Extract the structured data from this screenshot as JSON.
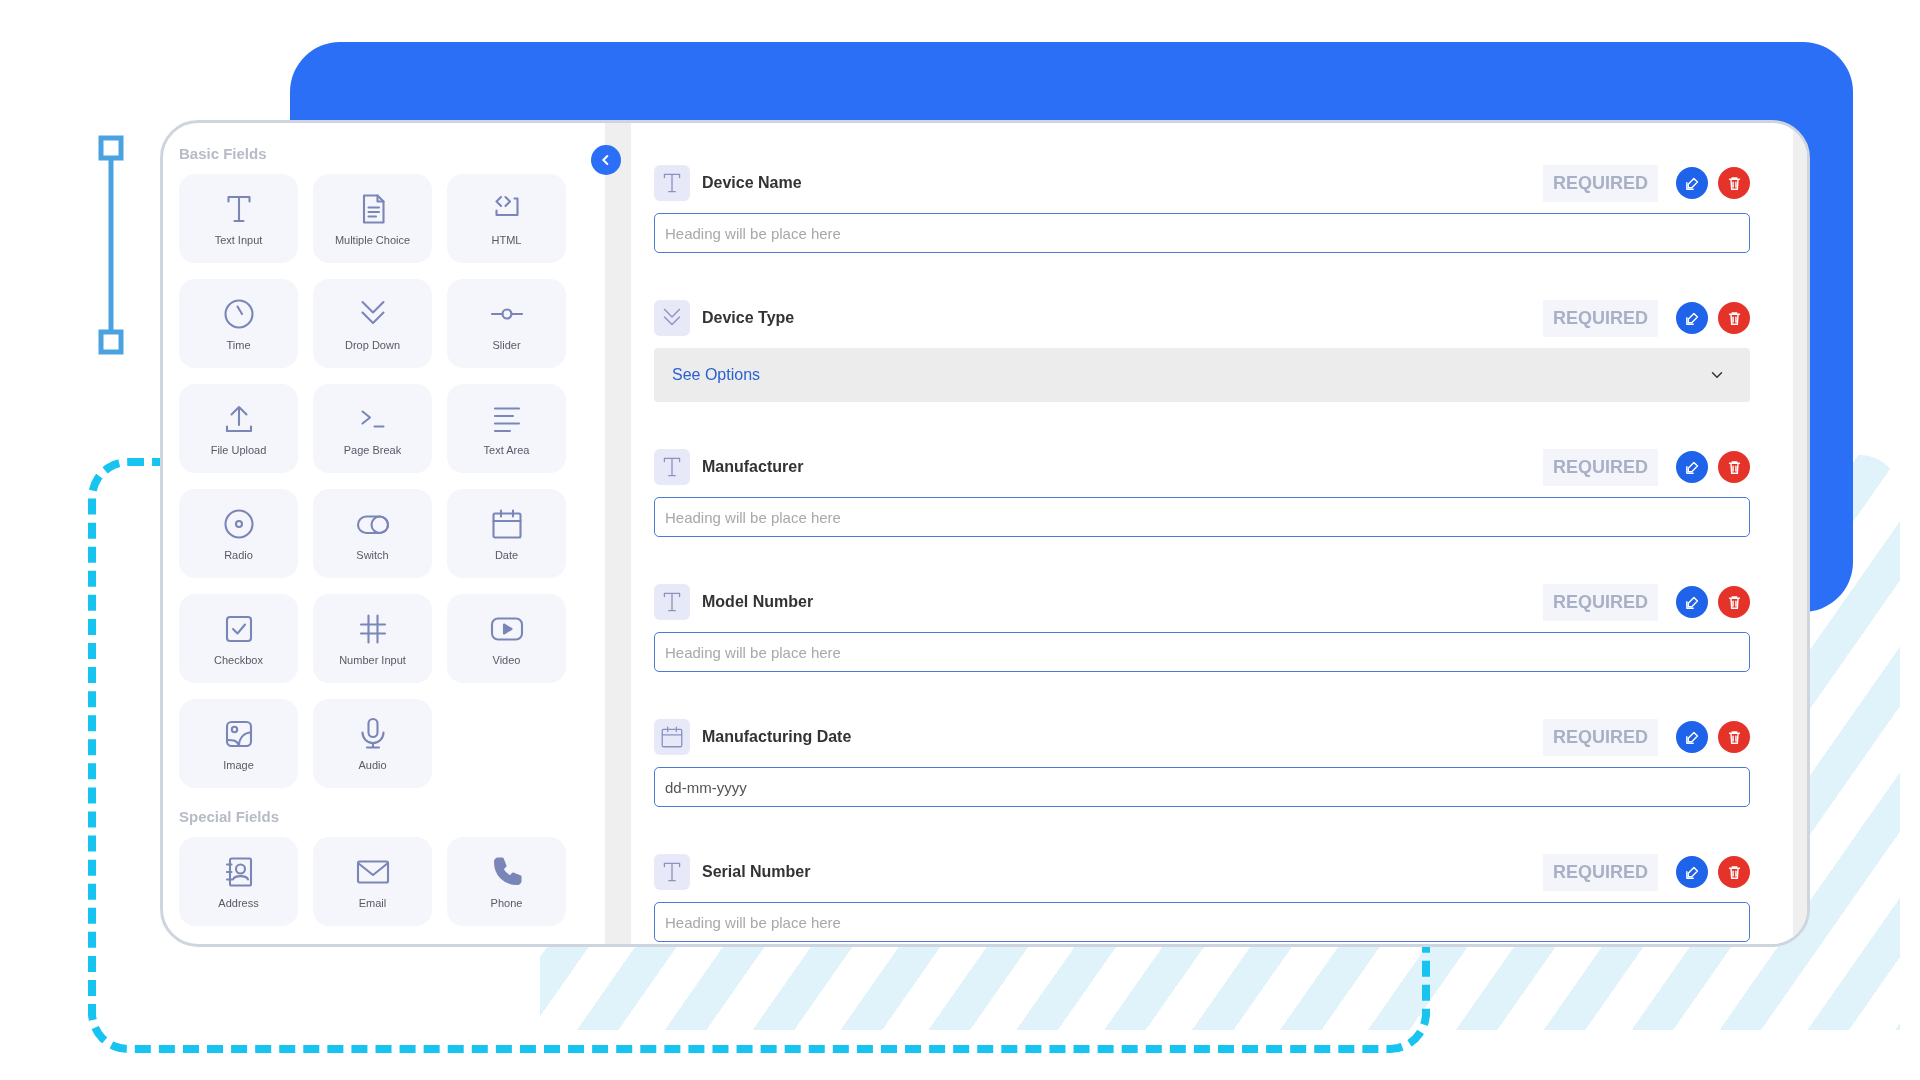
{
  "sidebar": {
    "sections": [
      {
        "title": "Basic Fields",
        "items": [
          {
            "label": "Text Input",
            "kind": "text"
          },
          {
            "label": "Multiple Choice",
            "kind": "choice"
          },
          {
            "label": "HTML",
            "kind": "html"
          },
          {
            "label": "Time",
            "kind": "time"
          },
          {
            "label": "Drop Down",
            "kind": "dropdown"
          },
          {
            "label": "Slider",
            "kind": "slider"
          },
          {
            "label": "File Upload",
            "kind": "upload"
          },
          {
            "label": "Page Break",
            "kind": "pagebreak"
          },
          {
            "label": "Text Area",
            "kind": "textarea"
          },
          {
            "label": "Radio",
            "kind": "radio"
          },
          {
            "label": "Switch",
            "kind": "switch"
          },
          {
            "label": "Date",
            "kind": "date"
          },
          {
            "label": "Checkbox",
            "kind": "checkbox"
          },
          {
            "label": "Number Input",
            "kind": "number"
          },
          {
            "label": "Video",
            "kind": "video"
          },
          {
            "label": "Image",
            "kind": "image"
          },
          {
            "label": "Audio",
            "kind": "audio"
          }
        ]
      },
      {
        "title": "Special Fields",
        "items": [
          {
            "label": "Address",
            "kind": "address"
          },
          {
            "label": "Email",
            "kind": "email"
          },
          {
            "label": "Phone",
            "kind": "phone"
          }
        ]
      }
    ]
  },
  "form": {
    "fields": [
      {
        "label": "Device Name",
        "kind": "text",
        "badge": "REQUIRED",
        "placeholder": "Heading will be place here"
      },
      {
        "label": "Device Type",
        "kind": "dropdown",
        "badge": "REQUIRED",
        "value": "See Options"
      },
      {
        "label": "Manufacturer",
        "kind": "text",
        "badge": "REQUIRED",
        "placeholder": "Heading will be place here"
      },
      {
        "label": "Model Number",
        "kind": "text",
        "badge": "REQUIRED",
        "placeholder": "Heading will be place here"
      },
      {
        "label": "Manufacturing Date",
        "kind": "date",
        "badge": "REQUIRED",
        "value": "dd-mm-yyyy"
      },
      {
        "label": "Serial Number",
        "kind": "text",
        "badge": "REQUIRED",
        "placeholder": "Heading will be place here"
      }
    ]
  }
}
